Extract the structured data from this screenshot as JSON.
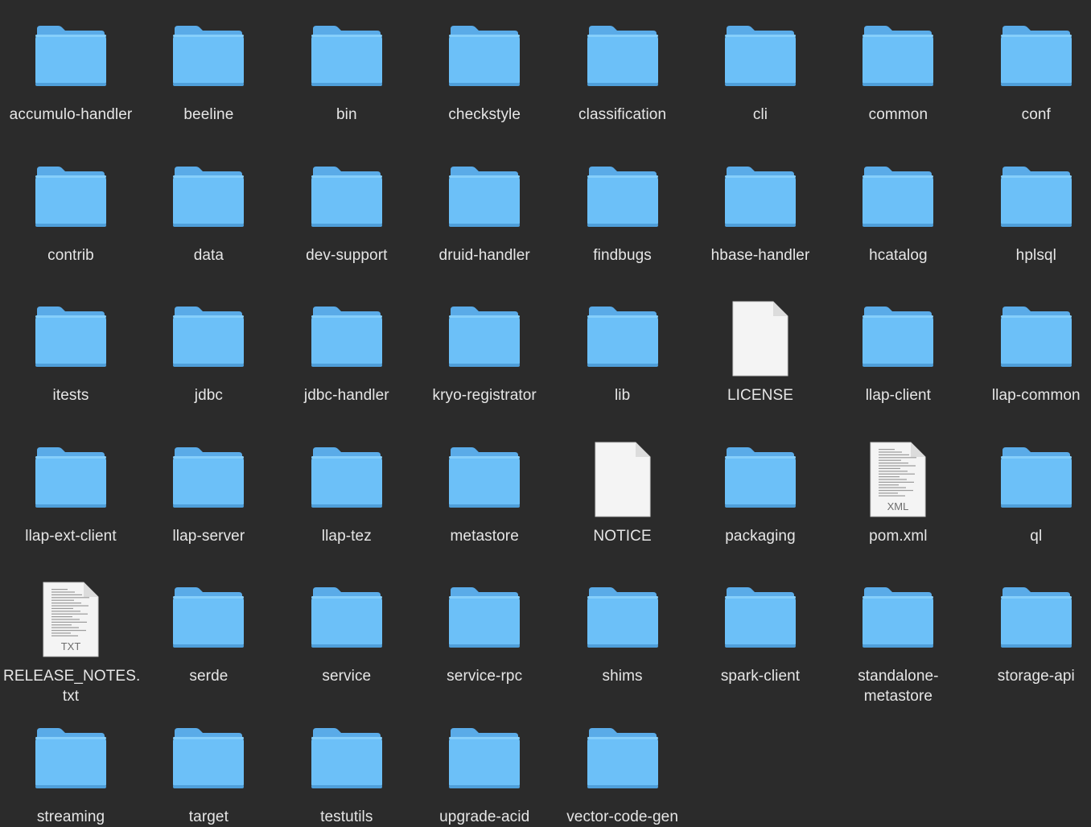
{
  "window": {
    "title": "",
    "view": "icon-view"
  },
  "items": [
    {
      "name": "accumulo-handler",
      "kind": "folder",
      "icon": "folder-icon"
    },
    {
      "name": "beeline",
      "kind": "folder",
      "icon": "folder-icon"
    },
    {
      "name": "bin",
      "kind": "folder",
      "icon": "folder-icon"
    },
    {
      "name": "checkstyle",
      "kind": "folder",
      "icon": "folder-icon"
    },
    {
      "name": "classification",
      "kind": "folder",
      "icon": "folder-icon"
    },
    {
      "name": "cli",
      "kind": "folder",
      "icon": "folder-icon"
    },
    {
      "name": "common",
      "kind": "folder",
      "icon": "folder-icon"
    },
    {
      "name": "conf",
      "kind": "folder",
      "icon": "folder-icon"
    },
    {
      "name": "contrib",
      "kind": "folder",
      "icon": "folder-icon"
    },
    {
      "name": "data",
      "kind": "folder",
      "icon": "folder-icon"
    },
    {
      "name": "dev-support",
      "kind": "folder",
      "icon": "folder-icon"
    },
    {
      "name": "druid-handler",
      "kind": "folder",
      "icon": "folder-icon"
    },
    {
      "name": "findbugs",
      "kind": "folder",
      "icon": "folder-icon"
    },
    {
      "name": "hbase-handler",
      "kind": "folder",
      "icon": "folder-icon"
    },
    {
      "name": "hcatalog",
      "kind": "folder",
      "icon": "folder-icon"
    },
    {
      "name": "hplsql",
      "kind": "folder",
      "icon": "folder-icon"
    },
    {
      "name": "itests",
      "kind": "folder",
      "icon": "folder-icon"
    },
    {
      "name": "jdbc",
      "kind": "folder",
      "icon": "folder-icon"
    },
    {
      "name": "jdbc-handler",
      "kind": "folder",
      "icon": "folder-icon"
    },
    {
      "name": "kryo-registrator",
      "kind": "folder",
      "icon": "folder-icon"
    },
    {
      "name": "lib",
      "kind": "folder",
      "icon": "folder-icon"
    },
    {
      "name": "LICENSE",
      "kind": "file",
      "icon": "blank-document-icon"
    },
    {
      "name": "llap-client",
      "kind": "folder",
      "icon": "folder-icon"
    },
    {
      "name": "llap-common",
      "kind": "folder",
      "icon": "folder-icon"
    },
    {
      "name": "llap-ext-client",
      "kind": "folder",
      "icon": "folder-icon"
    },
    {
      "name": "llap-server",
      "kind": "folder",
      "icon": "folder-icon"
    },
    {
      "name": "llap-tez",
      "kind": "folder",
      "icon": "folder-icon"
    },
    {
      "name": "metastore",
      "kind": "folder",
      "icon": "folder-icon"
    },
    {
      "name": "NOTICE",
      "kind": "file",
      "icon": "blank-document-icon"
    },
    {
      "name": "packaging",
      "kind": "folder",
      "icon": "folder-icon"
    },
    {
      "name": "pom.xml",
      "kind": "file",
      "icon": "xml-document-icon",
      "badge": "XML"
    },
    {
      "name": "ql",
      "kind": "folder",
      "icon": "folder-icon"
    },
    {
      "name": "RELEASE_NOTES.\ntxt",
      "kind": "file",
      "icon": "txt-document-icon",
      "badge": "TXT"
    },
    {
      "name": "serde",
      "kind": "folder",
      "icon": "folder-icon"
    },
    {
      "name": "service",
      "kind": "folder",
      "icon": "folder-icon"
    },
    {
      "name": "service-rpc",
      "kind": "folder",
      "icon": "folder-icon"
    },
    {
      "name": "shims",
      "kind": "folder",
      "icon": "folder-icon"
    },
    {
      "name": "spark-client",
      "kind": "folder",
      "icon": "folder-icon"
    },
    {
      "name": "standalone-\nmetastore",
      "kind": "folder",
      "icon": "folder-icon"
    },
    {
      "name": "storage-api",
      "kind": "folder",
      "icon": "folder-icon"
    },
    {
      "name": "streaming",
      "kind": "folder",
      "icon": "folder-icon"
    },
    {
      "name": "target",
      "kind": "folder",
      "icon": "folder-icon"
    },
    {
      "name": "testutils",
      "kind": "folder",
      "icon": "folder-icon"
    },
    {
      "name": "upgrade-acid",
      "kind": "folder",
      "icon": "folder-icon"
    },
    {
      "name": "vector-code-gen",
      "kind": "folder",
      "icon": "folder-icon"
    }
  ],
  "colors": {
    "background": "#2b2b2b",
    "folder_front": "#6cc0f8",
    "folder_back": "#5aabe8",
    "label": "#e6e6e6",
    "document": "#f4f4f4"
  }
}
